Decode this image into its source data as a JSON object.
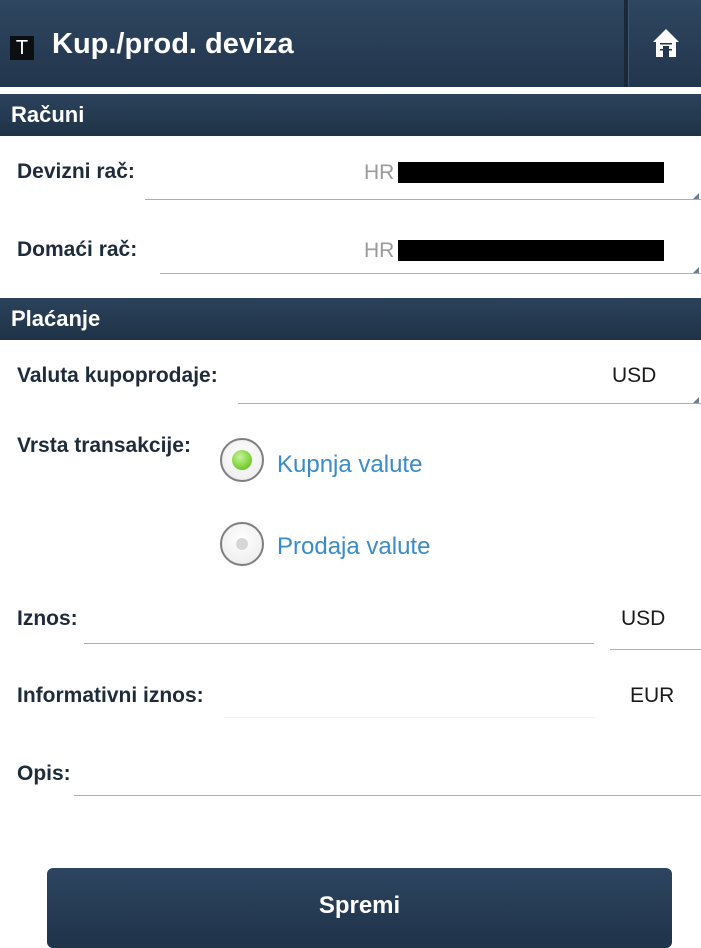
{
  "header": {
    "logo_text": "T",
    "title": "Kup./prod. deviza",
    "home_icon": "home-icon"
  },
  "accounts": {
    "section_title": "Računi",
    "foreign_label": "Devizni rač:",
    "foreign_value_prefix": "HR",
    "domestic_label": "Domaći rač:",
    "domestic_value_prefix": "HR"
  },
  "payment": {
    "section_title": "Plaćanje",
    "currency_label": "Valuta kupoprodaje:",
    "currency_value": "USD",
    "transaction_label": "Vrsta transakcije:",
    "option_buy": "Kupnja valute",
    "option_sell": "Prodaja valute",
    "selected_option": "Kupnja valute",
    "amount_label": "Iznos:",
    "amount_currency": "USD",
    "info_amount_label": "Informativni iznos:",
    "info_currency": "EUR",
    "description_label": "Opis:"
  },
  "actions": {
    "save_label": "Spremi"
  },
  "colors": {
    "header": "#22364d",
    "link": "#3a8bc8",
    "radio_active": "#7fd13b"
  }
}
